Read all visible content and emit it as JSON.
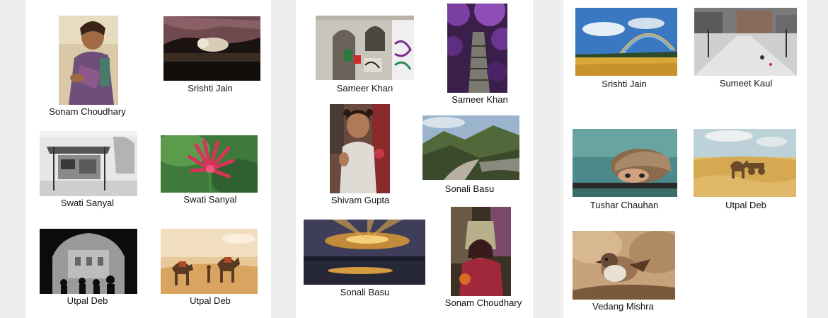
{
  "panels": [
    {
      "cards": [
        {
          "caption": "Sonam Choudhary",
          "subject": "child-portrait-icon"
        },
        {
          "caption": "Srishti Jain",
          "subject": "sleeping-dog-icon"
        },
        {
          "caption": "Swati Sanyal",
          "subject": "street-stall-icon"
        },
        {
          "caption": "Swati Sanyal",
          "subject": "red-flower-icon"
        },
        {
          "caption": "Utpal Deb",
          "subject": "arch-silhouette-icon"
        },
        {
          "caption": "Utpal Deb",
          "subject": "camel-desert-icon"
        }
      ]
    },
    {
      "cards": [
        {
          "caption": "Sameer Khan",
          "subject": "graffiti-door-icon"
        },
        {
          "caption": "Sameer Khan",
          "subject": "purple-forest-stairs-icon"
        },
        {
          "caption": "Shivam Gupta",
          "subject": "girl-portrait-icon"
        },
        {
          "caption": "Sonali Basu",
          "subject": "mountain-valley-icon"
        },
        {
          "caption": "Sonali Basu",
          "subject": "sunset-lake-icon"
        },
        {
          "caption": "Sonam Choudhary",
          "subject": "woman-portrait-icon"
        }
      ]
    },
    {
      "cards": [
        {
          "caption": "Srishti Jain",
          "subject": "rainbow-field-icon"
        },
        {
          "caption": "Sumeet Kaul",
          "subject": "snowy-street-icon"
        },
        {
          "caption": "Tushar Chauhan",
          "subject": "peeking-eyes-icon"
        },
        {
          "caption": "Utpal Deb",
          "subject": "camel-cart-desert-icon"
        },
        {
          "caption": "Vedang Mishra",
          "subject": "sparrow-icon"
        }
      ]
    }
  ]
}
